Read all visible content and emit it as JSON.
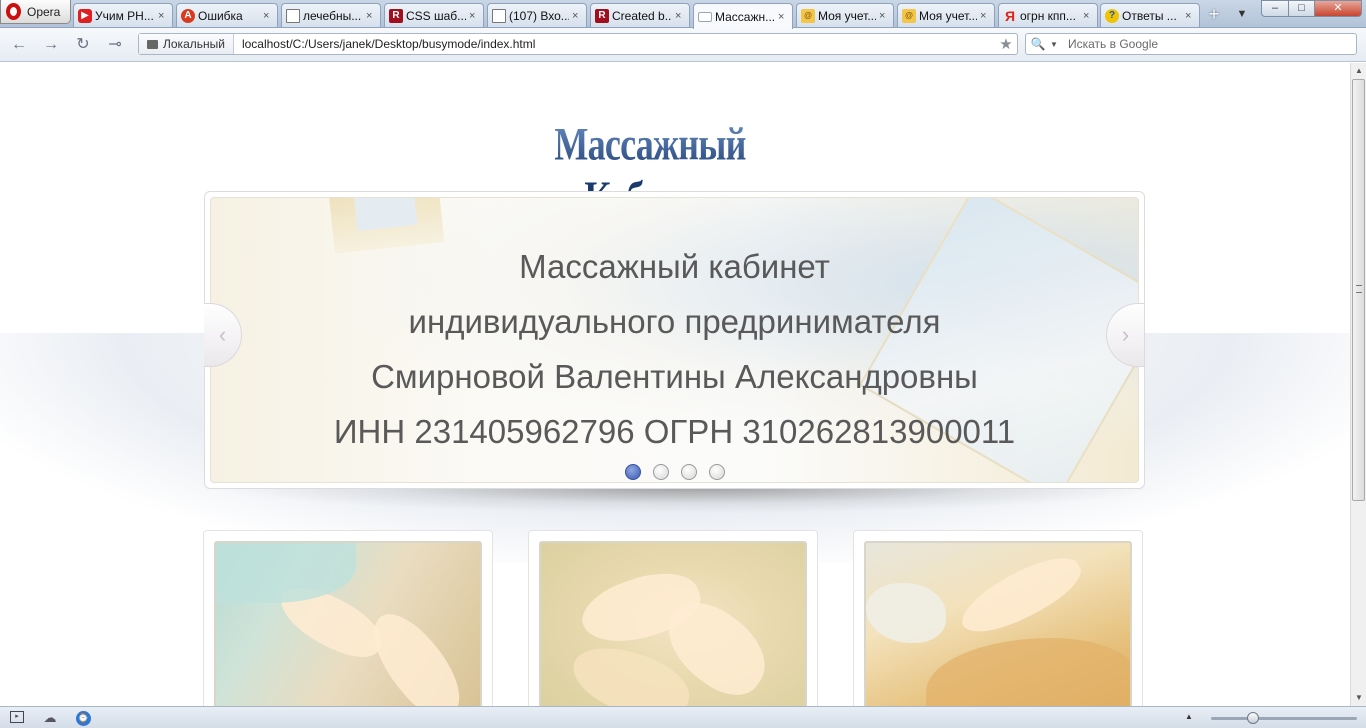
{
  "browser": {
    "menu_label": "Opera",
    "tabs": [
      {
        "label": "Учим PH...",
        "icon": "youtube-icon"
      },
      {
        "label": "Ошибка",
        "icon": "error-icon"
      },
      {
        "label": "лечебны...",
        "icon": "document-icon"
      },
      {
        "label": "CSS шаб...",
        "icon": "r-icon"
      },
      {
        "label": "(107) Вхо...",
        "icon": "document-icon"
      },
      {
        "label": "Created b...",
        "icon": "r-icon"
      },
      {
        "label": "Массажн...",
        "icon": "page-icon",
        "active": true
      },
      {
        "label": "Моя учет...",
        "icon": "mail-icon"
      },
      {
        "label": "Моя учет...",
        "icon": "mail-icon"
      },
      {
        "label": "огрн кпп...",
        "icon": "yandex-icon"
      },
      {
        "label": "Ответы ...",
        "icon": "answers-icon"
      }
    ],
    "close_glyph": "×",
    "new_tab_glyph": "+",
    "tab_menu_glyph": "▼",
    "window": {
      "minimize": "–",
      "maximize": "□",
      "close": "✕"
    },
    "nav": {
      "back": "←",
      "forward": "→",
      "reload": "↻",
      "key": "⊸"
    },
    "address": {
      "badge": "Локальный",
      "url": "localhost/C:/Users/janek/Desktop/busymode/index.html",
      "star": "★"
    },
    "search": {
      "placeholder": "Искать в Google",
      "icon": "🔍",
      "dropdown": "▼"
    },
    "scroll": {
      "up": "▲",
      "down": "▼",
      "position": 0.0
    },
    "status": {
      "panel": "▸",
      "cloud": "☁",
      "speed": "⌚",
      "zoom_caret": "▲",
      "zoom_fraction": 0.25
    }
  },
  "page": {
    "site_title": "Массажный Кабинет",
    "slider": {
      "lines": [
        "Массажный кабинет",
        "индивидуального предринимателя",
        "Смирновой Валентины Александровны",
        "ИНН 231405962796 ОГРН 310262813900011"
      ],
      "prev_glyph": "‹",
      "next_glyph": "›",
      "dots": 4,
      "active_dot": 0
    },
    "cards": [
      {
        "image": "massage-back-photo"
      },
      {
        "image": "massage-neck-photo"
      },
      {
        "image": "massage-shoulder-photo"
      }
    ]
  },
  "colors": {
    "title_blue": "#1f3f74",
    "slide_text": "#595959",
    "active_dot": "#3b59b3",
    "tabbar": "#c9d6e6"
  }
}
